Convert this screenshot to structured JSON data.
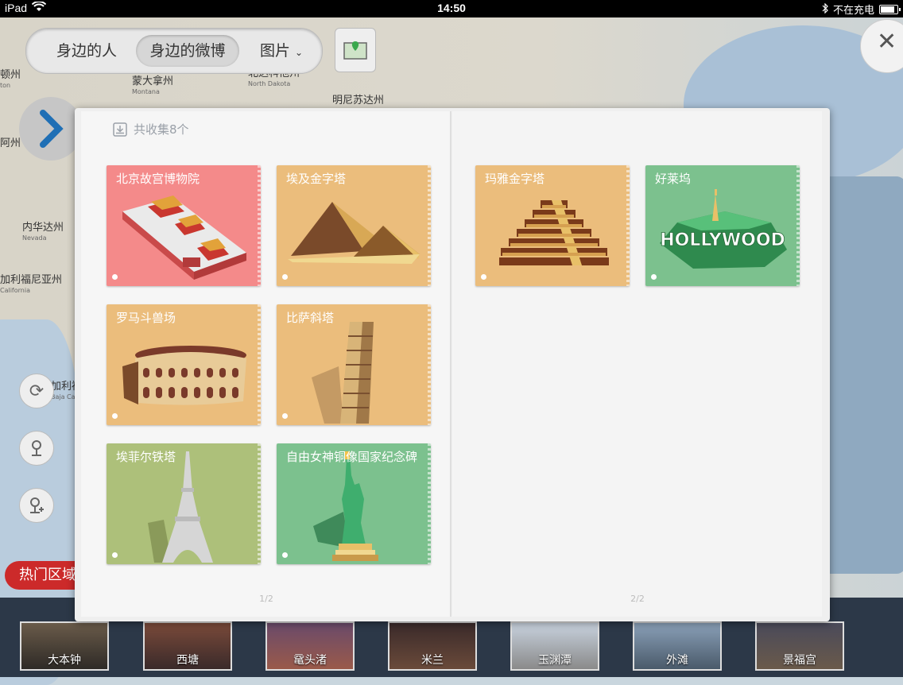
{
  "status_bar": {
    "device": "iPad",
    "time": "14:50",
    "charging": "不在充电"
  },
  "segmented": {
    "options": [
      "身边的人",
      "身边的微博",
      "图片"
    ],
    "selected": "身边的微博"
  },
  "map_labels": [
    {
      "cn": "蒙大拿州",
      "en": "Montana"
    },
    {
      "cn": "北达科他州",
      "en": "North Dakota"
    },
    {
      "cn": "明尼苏达州",
      "en": ""
    },
    {
      "cn": "内华达州",
      "en": "Nevada"
    },
    {
      "cn": "加利福尼亚州",
      "en": "California"
    },
    {
      "cn": "加利福",
      "en": "Baja Ca"
    },
    {
      "cn": "阿州",
      "en": ""
    },
    {
      "cn": "顿州",
      "en": "ton"
    }
  ],
  "hot_areas_label": "热门区域",
  "bottom_thumbs": [
    "大本钟",
    "西塘",
    "鼋头渚",
    "米兰",
    "玉渊潭",
    "外滩",
    "景福宫"
  ],
  "book": {
    "count_text": "共收集8个",
    "page_left": "1/2",
    "page_right": "2/2",
    "cards_left": [
      {
        "title": "北京故宫博物院",
        "color": "#f48a8a"
      },
      {
        "title": "埃及金字塔",
        "color": "#ebbd7c"
      },
      {
        "title": "罗马斗兽场",
        "color": "#ebbd7c"
      },
      {
        "title": "比萨斜塔",
        "color": "#ebbd7c"
      },
      {
        "title": "埃菲尔铁塔",
        "color": "#adc07a"
      },
      {
        "title": "自由女神铜像国家纪念碑",
        "color": "#7cc18e"
      }
    ],
    "cards_right": [
      {
        "title": "玛雅金字塔",
        "color": "#ebbd7c"
      },
      {
        "title": "好莱坞",
        "color": "#7cc18e"
      }
    ],
    "hollywood_sign": "HOLLYWOOD"
  },
  "icons": {
    "wifi": "wifi-icon",
    "bluetooth": "bluetooth-icon",
    "battery": "battery-icon",
    "close": "close-icon",
    "map": "map-icon",
    "refresh": "refresh-icon",
    "locate": "person-pin-icon",
    "add_location": "add-person-icon",
    "download": "download-icon"
  }
}
